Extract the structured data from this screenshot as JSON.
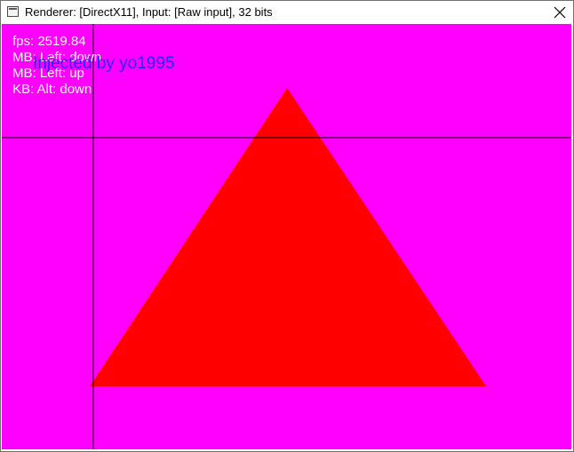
{
  "window": {
    "title": "Renderer: [DirectX11], Input: [Raw input], 32 bits",
    "icon": "app-window-icon",
    "close_icon": "close-icon"
  },
  "canvas": {
    "background_color": "#ff00ff",
    "shape": {
      "type": "triangle",
      "color": "#ff0000"
    },
    "crosshair_color": "#000000"
  },
  "stats": {
    "fps": "fps: 2519.84",
    "mouse_down": "MB: Left: down",
    "mouse_up": "MB: Left: up",
    "keyboard": "KB: Alt: down"
  },
  "watermark": {
    "text": "Injected by yo1995",
    "color": "#2323ff"
  }
}
